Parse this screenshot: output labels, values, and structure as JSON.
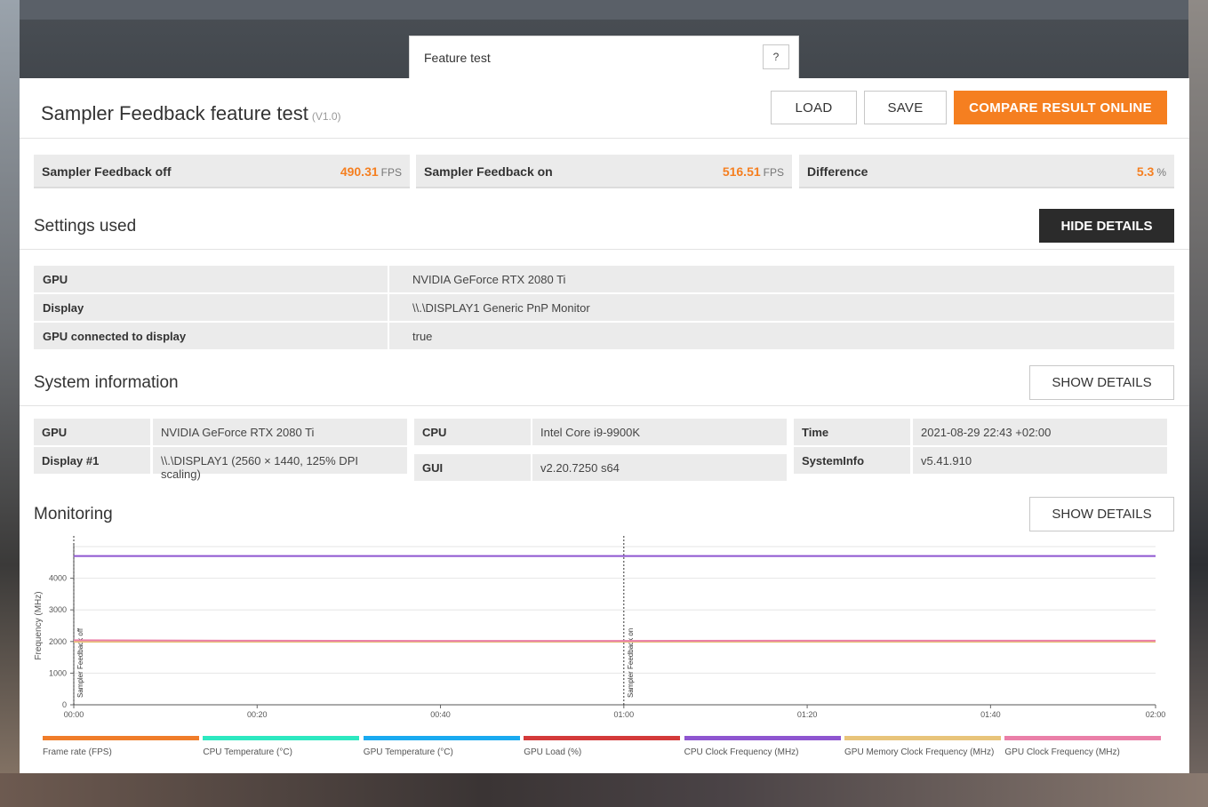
{
  "tab": {
    "label": "Feature test",
    "help": "?"
  },
  "header": {
    "title": "Sampler Feedback feature test",
    "version": "(V1.0)",
    "load": "LOAD",
    "save": "SAVE",
    "compare": "COMPARE RESULT ONLINE"
  },
  "scores": [
    {
      "label": "Sampler Feedback off",
      "value": "490.31",
      "unit": "FPS"
    },
    {
      "label": "Sampler Feedback on",
      "value": "516.51",
      "unit": "FPS"
    },
    {
      "label": "Difference",
      "value": "5.3",
      "unit": "%"
    }
  ],
  "settings": {
    "title": "Settings used",
    "toggle": "HIDE DETAILS",
    "rows": [
      {
        "key": "GPU",
        "value": "NVIDIA GeForce RTX 2080 Ti"
      },
      {
        "key": "Display",
        "value": "\\\\.\\DISPLAY1 Generic PnP Monitor"
      },
      {
        "key": "GPU connected to display",
        "value": "true"
      }
    ]
  },
  "sysinfo": {
    "title": "System information",
    "toggle": "SHOW DETAILS",
    "gpu_key": "GPU",
    "gpu_val": "NVIDIA GeForce RTX 2080 Ti",
    "display_key": "Display #1",
    "display_val": "\\\\.\\DISPLAY1 (2560 × 1440, 125% DPI scaling)",
    "cpu_key": "CPU",
    "cpu_val": "Intel Core i9-9900K",
    "gui_key": "GUI",
    "gui_val": "v2.20.7250 s64",
    "time_key": "Time",
    "time_val": "2021-08-29 22:43 +02:00",
    "si_key": "SystemInfo",
    "si_val": "v5.41.910"
  },
  "monitoring": {
    "title": "Monitoring",
    "toggle": "SHOW DETAILS"
  },
  "chart_data": {
    "type": "line",
    "ylabel": "Frequency (MHz)",
    "ylim": [
      0,
      5000
    ],
    "yticks": [
      "0",
      "1000",
      "2000",
      "3000",
      "4000"
    ],
    "xticks": [
      "00:00",
      "00:20",
      "00:40",
      "01:00",
      "01:20",
      "01:40",
      "02:00"
    ],
    "x_seconds": [
      0,
      20,
      40,
      60,
      80,
      100,
      118
    ],
    "markers": [
      {
        "label": "Sampler Feedback off",
        "t": 0
      },
      {
        "label": "Sampler Feedback on",
        "t": 60
      }
    ],
    "series": [
      {
        "name": "Frame rate (FPS)",
        "color": "#f07d2a",
        "values": []
      },
      {
        "name": "CPU Temperature (°C)",
        "color": "#2de8c0",
        "values": []
      },
      {
        "name": "GPU Temperature (°C)",
        "color": "#1aaaf0",
        "values": []
      },
      {
        "name": "GPU Load (%)",
        "color": "#d43a3a",
        "values": []
      },
      {
        "name": "CPU Clock Frequency (MHz)",
        "color": "#8e55d0",
        "values": [
          4700,
          4700,
          4700,
          4700,
          4700,
          4700,
          4700
        ]
      },
      {
        "name": "GPU Memory Clock Frequency (MHz)",
        "color": "#e8c47a",
        "values": [
          1990,
          1990,
          1990,
          1990,
          1990,
          1990,
          1990
        ]
      },
      {
        "name": "GPU Clock Frequency (MHz)",
        "color": "#ea7fa8",
        "values": [
          2040,
          2025,
          2020,
          2020,
          2025,
          2025,
          2025
        ]
      }
    ]
  }
}
